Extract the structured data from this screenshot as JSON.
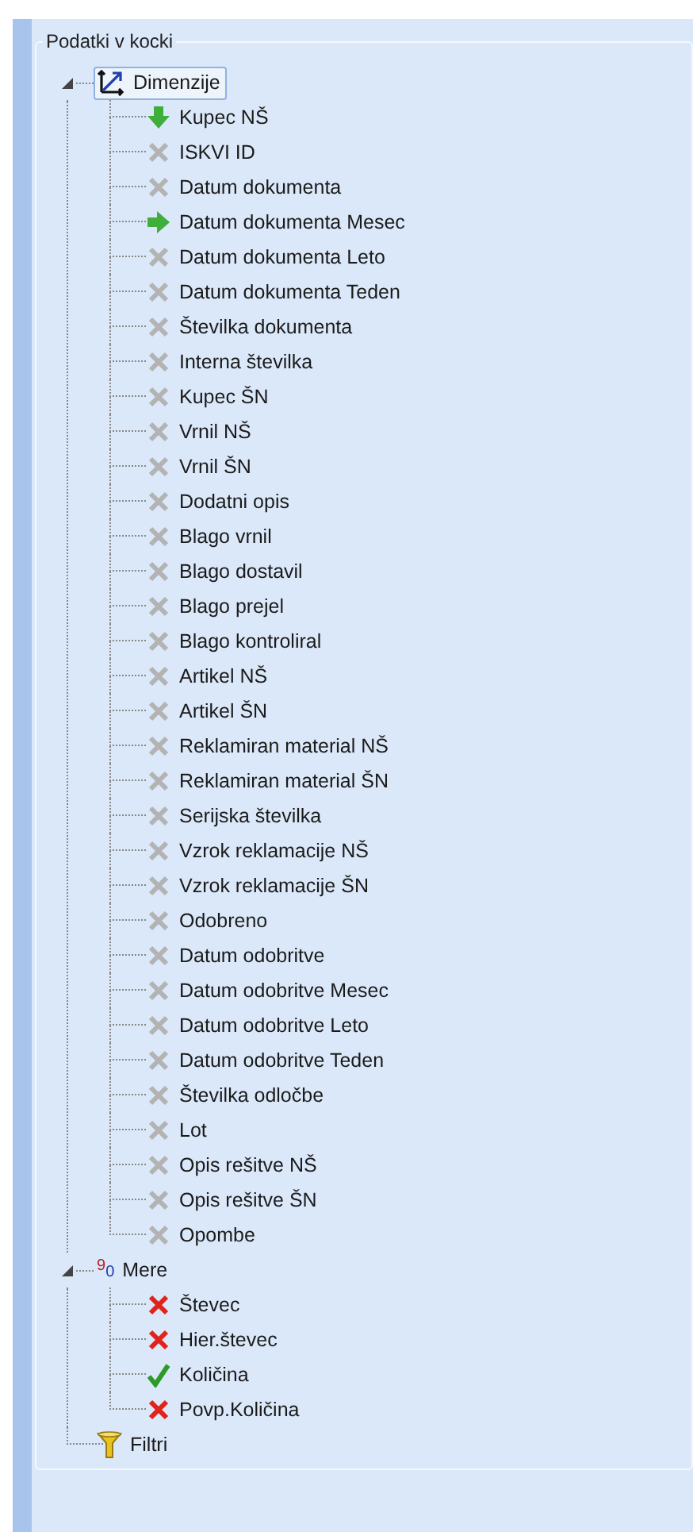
{
  "group_title": "Podatki v kocki",
  "tree": [
    {
      "label": "Dimenzije",
      "kind": "dimensions",
      "selected": true,
      "expanded": true,
      "children": [
        {
          "label": "Kupec NŠ",
          "kind": "down"
        },
        {
          "label": "ISKVI ID",
          "kind": "off"
        },
        {
          "label": "Datum dokumenta",
          "kind": "off"
        },
        {
          "label": "Datum dokumenta Mesec",
          "kind": "right"
        },
        {
          "label": "Datum dokumenta Leto",
          "kind": "off"
        },
        {
          "label": "Datum dokumenta Teden",
          "kind": "off"
        },
        {
          "label": "Številka dokumenta",
          "kind": "off"
        },
        {
          "label": "Interna številka",
          "kind": "off"
        },
        {
          "label": "Kupec ŠN",
          "kind": "off"
        },
        {
          "label": "Vrnil NŠ",
          "kind": "off"
        },
        {
          "label": "Vrnil ŠN",
          "kind": "off"
        },
        {
          "label": "Dodatni opis",
          "kind": "off"
        },
        {
          "label": "Blago vrnil",
          "kind": "off"
        },
        {
          "label": "Blago dostavil",
          "kind": "off"
        },
        {
          "label": "Blago prejel",
          "kind": "off"
        },
        {
          "label": "Blago kontroliral",
          "kind": "off"
        },
        {
          "label": "Artikel NŠ",
          "kind": "off"
        },
        {
          "label": "Artikel ŠN",
          "kind": "off"
        },
        {
          "label": "Reklamiran material NŠ",
          "kind": "off"
        },
        {
          "label": "Reklamiran material ŠN",
          "kind": "off"
        },
        {
          "label": "Serijska številka",
          "kind": "off"
        },
        {
          "label": "Vzrok reklamacije NŠ",
          "kind": "off"
        },
        {
          "label": "Vzrok reklamacije ŠN",
          "kind": "off"
        },
        {
          "label": "Odobreno",
          "kind": "off"
        },
        {
          "label": "Datum odobritve",
          "kind": "off"
        },
        {
          "label": "Datum odobritve Mesec",
          "kind": "off"
        },
        {
          "label": "Datum odobritve Leto",
          "kind": "off"
        },
        {
          "label": "Datum odobritve Teden",
          "kind": "off"
        },
        {
          "label": "Številka odločbe",
          "kind": "off"
        },
        {
          "label": "Lot",
          "kind": "off"
        },
        {
          "label": "Opis rešitve NŠ",
          "kind": "off"
        },
        {
          "label": "Opis rešitve ŠN",
          "kind": "off"
        },
        {
          "label": "Opombe",
          "kind": "off"
        }
      ]
    },
    {
      "label": "Mere",
      "kind": "measures",
      "icon_glyphs": [
        "9",
        "0"
      ],
      "selected": false,
      "expanded": true,
      "children": [
        {
          "label": "Števec",
          "kind": "removed"
        },
        {
          "label": "Hier.števec",
          "kind": "removed"
        },
        {
          "label": "Količina",
          "kind": "checked"
        },
        {
          "label": "Povp.Količina",
          "kind": "removed"
        }
      ]
    },
    {
      "label": "Filtri",
      "kind": "filters",
      "selected": false
    }
  ]
}
